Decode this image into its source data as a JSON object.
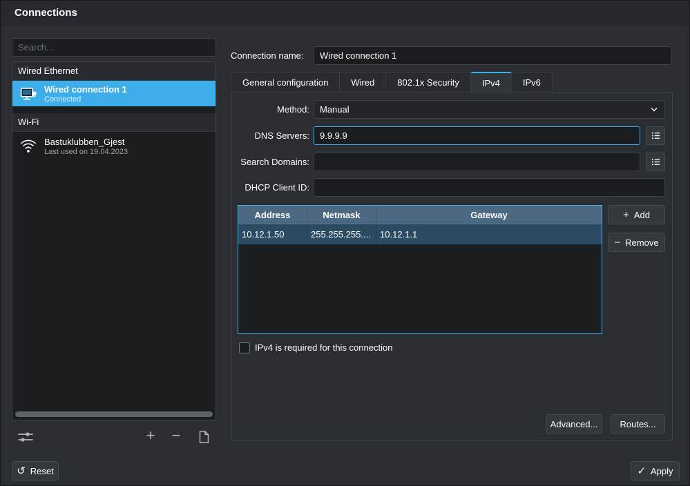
{
  "titlebar": {
    "title": "Connections"
  },
  "sidebar": {
    "search": {
      "placeholder": "Search..."
    },
    "wired_section": {
      "label": "Wired Ethernet"
    },
    "wired_item": {
      "name": "Wired connection 1",
      "status": "Connected"
    },
    "wifi_section": {
      "label": "Wi-Fi"
    },
    "wifi_item": {
      "name": "Bastuklubben_Gjest",
      "status": "Last used on 19.04.2023"
    }
  },
  "connection": {
    "name_label": "Connection name:",
    "name_value": "Wired connection 1"
  },
  "tabs": {
    "general": "General configuration",
    "wired": "Wired",
    "security": "802.1x Security",
    "ipv4": "IPv4",
    "ipv6": "IPv6"
  },
  "ipv4": {
    "method_label": "Method:",
    "method_value": "Manual",
    "dns_label": "DNS Servers:",
    "dns_value": "9.9.9.9",
    "search_domains_label": "Search Domains:",
    "search_domains_value": "",
    "dhcp_label": "DHCP Client ID:",
    "dhcp_value": "",
    "addresses": {
      "headers": {
        "address": "Address",
        "netmask": "Netmask",
        "gateway": "Gateway"
      },
      "rows": [
        {
          "address": "10.12.1.50",
          "netmask": "255.255.255....",
          "gateway": "10.12.1.1"
        }
      ]
    },
    "add_label": "Add",
    "remove_label": "Remove",
    "required_label": "IPv4 is required for this connection",
    "advanced_label": "Advanced...",
    "routes_label": "Routes..."
  },
  "footer": {
    "reset_label": "Reset",
    "apply_label": "Apply"
  },
  "icons": {
    "add": "+",
    "remove": "−",
    "reset": "↺",
    "apply": "✓"
  },
  "colors": {
    "highlight": "#3daee9",
    "table_header": "#4c6983",
    "selected_row": "#2a4b61"
  }
}
